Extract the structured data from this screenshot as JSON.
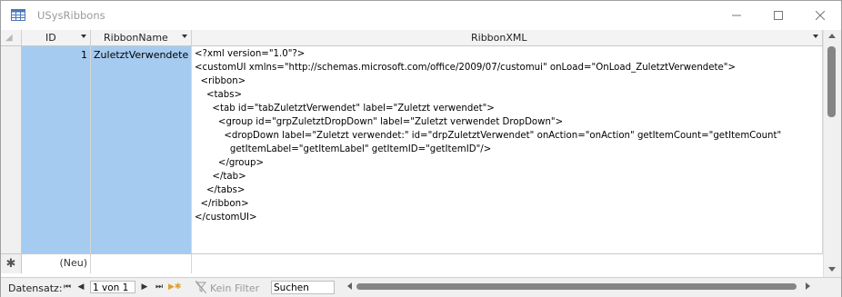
{
  "window": {
    "title": "USysRibbons",
    "controls": {
      "minimize_icon": "minimize-icon",
      "maximize_icon": "maximize-icon",
      "close_icon": "close-icon"
    }
  },
  "table": {
    "columns": [
      {
        "label": "ID",
        "dropdown": true
      },
      {
        "label": "RibbonName",
        "dropdown": true
      },
      {
        "label": "RibbonXML",
        "dropdown": true
      }
    ],
    "rows": [
      {
        "id": "1",
        "ribbon_name": "ZuletztVerwendete",
        "ribbon_xml_lines": [
          "<?xml version=\"1.0\"?>",
          "<customUI xmlns=\"http://schemas.microsoft.com/office/2009/07/customui\" onLoad=\"OnLoad_ZuletztVerwendete\">",
          "  <ribbon>",
          "    <tabs>",
          "      <tab id=\"tabZuletztVerwendet\" label=\"Zuletzt verwendet\">",
          "        <group id=\"grpZuletztDropDown\" label=\"Zuletzt verwendet DropDown\">",
          "          <dropDown label=\"Zuletzt verwendet:\" id=\"drpZuletztVerwendet\" onAction=\"onAction\" getItemCount=\"getItemCount\"",
          "            getItemLabel=\"getItemLabel\" getItemID=\"getItemID\"/>",
          "        </group>",
          "      </tab>",
          "    </tabs>",
          "  </ribbon>",
          "</customUI>"
        ]
      }
    ],
    "new_row": {
      "id_placeholder": "(Neu)",
      "selector_symbol": "✱"
    }
  },
  "navigation": {
    "label": "Datensatz:",
    "position": "1 von 1",
    "filter_label": "Kein Filter",
    "search_value": "Suchen",
    "buttons": [
      "first",
      "previous",
      "next",
      "last",
      "new"
    ]
  },
  "colors": {
    "selected_cell": "#a6cbf0",
    "header_bg": "#f3f3f3",
    "scrollbar_thumb": "#858585"
  }
}
